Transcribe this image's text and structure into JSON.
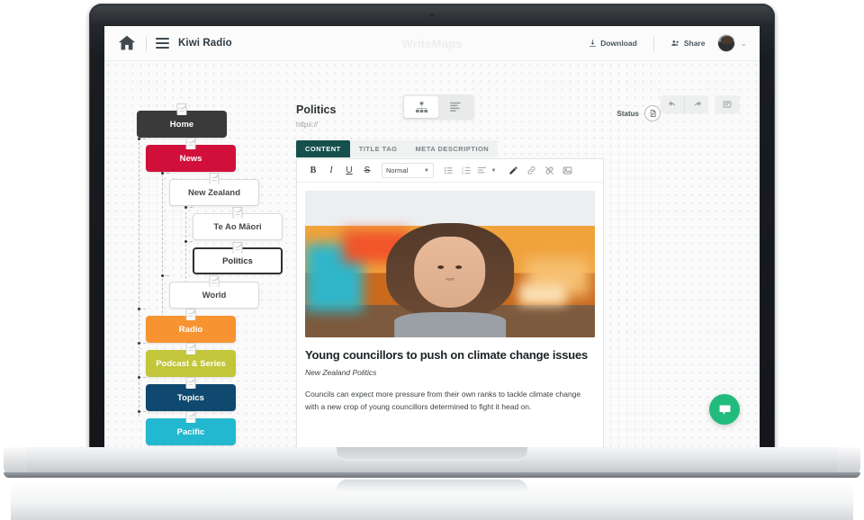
{
  "header": {
    "home_icon": "home-icon",
    "menu_icon": "hamburger-menu-icon",
    "project_name": "Kiwi Radio",
    "app_title": "WriteMaps",
    "download_label": "Download",
    "share_label": "Share",
    "download_icon": "download-icon",
    "share_icon": "share-users-icon",
    "avatar": "user-avatar",
    "chevron": "⌄"
  },
  "toolbar": {
    "views": [
      {
        "name": "sitemap-view",
        "icon": "sitemap-tree-icon",
        "active": true
      },
      {
        "name": "list-view",
        "icon": "list-view-icon",
        "active": false
      }
    ],
    "undo_icon": "undo-arrow-icon",
    "redo_icon": "redo-arrow-icon",
    "comment_icon": "comment-note-icon"
  },
  "sitemap": {
    "nodes": [
      {
        "label": "Home",
        "color": "dark",
        "level": 0
      },
      {
        "label": "News",
        "color": "red",
        "level": 1
      },
      {
        "label": "New Zealand",
        "color": "white",
        "level": 2
      },
      {
        "label": "Te Ao Māori",
        "color": "white",
        "level": 3
      },
      {
        "label": "Politics",
        "color": "white",
        "level": 3,
        "selected": true
      },
      {
        "label": "World",
        "color": "white",
        "level": 2
      },
      {
        "label": "Radio",
        "color": "orange",
        "level": 1
      },
      {
        "label": "Podcast & Series",
        "color": "olive",
        "level": 1
      },
      {
        "label": "Topics",
        "color": "navy",
        "level": 1
      },
      {
        "label": "Pacific",
        "color": "cyan",
        "level": 1
      }
    ],
    "node_icon": "page-document-icon"
  },
  "detail": {
    "page_title": "Politics",
    "page_url": "https://",
    "status_label": "Status",
    "status_icon": "page-status-icon",
    "tabs": [
      {
        "label": "CONTENT",
        "active": true
      },
      {
        "label": "TITLE TAG",
        "active": false
      },
      {
        "label": "META DESCRIPTION",
        "active": false
      }
    ]
  },
  "editor": {
    "tools": [
      {
        "name": "bold-button",
        "glyph": "B"
      },
      {
        "name": "italic-button",
        "glyph": "I"
      },
      {
        "name": "underline-button",
        "glyph": "U"
      },
      {
        "name": "strikethrough-button",
        "glyph": "S"
      }
    ],
    "format_value": "Normal",
    "bullet_list_icon": "bullet-list-icon",
    "numbered_list_icon": "numbered-list-icon",
    "align_icon": "text-align-icon",
    "pen_icon": "pen-highlight-icon",
    "link_icon": "link-icon",
    "unlink_icon": "unlink-icon",
    "image_icon": "insert-image-icon",
    "content": {
      "image_alt": "young-woman-portrait-photo",
      "headline": "Young councillors to push on climate change issues",
      "byline": "New Zealand Politics",
      "paragraph": "Councils can expect more pressure from their own ranks to tackle climate change with a new crop of young councillors determined to fight it head on."
    }
  },
  "chat": {
    "icon": "chat-bubble-icon",
    "color": "#22bb7e"
  },
  "colors": {
    "accent_red": "#d0103a",
    "tab_active": "#16504d",
    "orange": "#f79431",
    "olive": "#c2c63a",
    "navy": "#10496f",
    "cyan": "#22b8cf",
    "dark": "#3a3a3a"
  }
}
